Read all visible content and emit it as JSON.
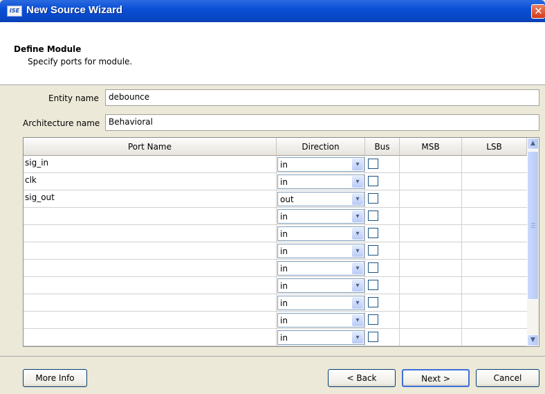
{
  "window": {
    "title": "New Source Wizard",
    "app_icon_text": "ISE",
    "close_glyph": "✕"
  },
  "header": {
    "title": "Define Module",
    "subtitle": "Specify ports for module."
  },
  "form": {
    "entity_label": "Entity name",
    "entity_value": "debounce",
    "arch_label": "Architecture name",
    "arch_value": "Behavioral"
  },
  "ports_table": {
    "columns": [
      "Port Name",
      "Direction",
      "Bus",
      "MSB",
      "LSB"
    ],
    "rows": [
      {
        "port_name": "sig_in",
        "direction": "in",
        "bus": false,
        "msb": "",
        "lsb": ""
      },
      {
        "port_name": "clk",
        "direction": "in",
        "bus": false,
        "msb": "",
        "lsb": ""
      },
      {
        "port_name": "sig_out",
        "direction": "out",
        "bus": false,
        "msb": "",
        "lsb": ""
      },
      {
        "port_name": "",
        "direction": "in",
        "bus": false,
        "msb": "",
        "lsb": ""
      },
      {
        "port_name": "",
        "direction": "in",
        "bus": false,
        "msb": "",
        "lsb": ""
      },
      {
        "port_name": "",
        "direction": "in",
        "bus": false,
        "msb": "",
        "lsb": ""
      },
      {
        "port_name": "",
        "direction": "in",
        "bus": false,
        "msb": "",
        "lsb": ""
      },
      {
        "port_name": "",
        "direction": "in",
        "bus": false,
        "msb": "",
        "lsb": ""
      },
      {
        "port_name": "",
        "direction": "in",
        "bus": false,
        "msb": "",
        "lsb": ""
      },
      {
        "port_name": "",
        "direction": "in",
        "bus": false,
        "msb": "",
        "lsb": ""
      },
      {
        "port_name": "",
        "direction": "in",
        "bus": false,
        "msb": "",
        "lsb": ""
      }
    ],
    "dropdown_glyph": "▾",
    "scroll_up_glyph": "▲",
    "scroll_down_glyph": "▼"
  },
  "buttons": {
    "more_info": "More Info",
    "back": "< Back",
    "next": "Next >",
    "cancel": "Cancel"
  },
  "colors": {
    "titlebar": "#0a4fd6",
    "dialog_bg": "#ece9d8",
    "button_border": "#003c74"
  }
}
